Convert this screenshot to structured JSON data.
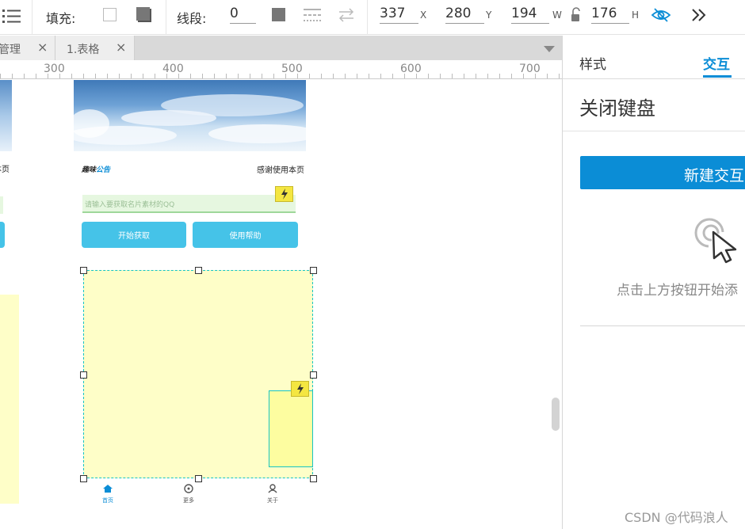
{
  "toolbar": {
    "fill_label": "填充:",
    "stroke_label": "线段:",
    "stroke_value": "0",
    "x_value": "337",
    "x_unit": "X",
    "y_value": "280",
    "y_unit": "Y",
    "w_value": "194",
    "w_unit": "W",
    "h_value": "176",
    "h_unit": "H"
  },
  "tabs": [
    {
      "label": "管理",
      "close": "×"
    },
    {
      "label": "1.表格",
      "close": "×"
    }
  ],
  "ruler": {
    "marks": [
      "300",
      "400",
      "500",
      "600",
      "700"
    ]
  },
  "canvas": {
    "left_card_text": "本页",
    "card": {
      "brand_text_a": "趣味",
      "brand_text_b": "公告",
      "right_text": "感谢使用本页",
      "input_placeholder": "请输入要获取名片素材的QQ",
      "btn_start": "开始获取",
      "btn_help": "使用帮助"
    },
    "nav": [
      "首页",
      "更多",
      "关于"
    ]
  },
  "panel": {
    "tab_style": "样式",
    "tab_interact": "交互",
    "title": "关闭键盘",
    "new_button": "新建交互",
    "hint": "点击上方按钮开始添",
    "watermark": "CSDN @代码浪人"
  },
  "colors": {
    "accent": "#0b8dd6",
    "input_green": "#e6f7e0",
    "button_blue": "#45c3e8",
    "yellow": "#fefec8",
    "lightning": "#f4e641",
    "selection": "#17c4c4"
  }
}
